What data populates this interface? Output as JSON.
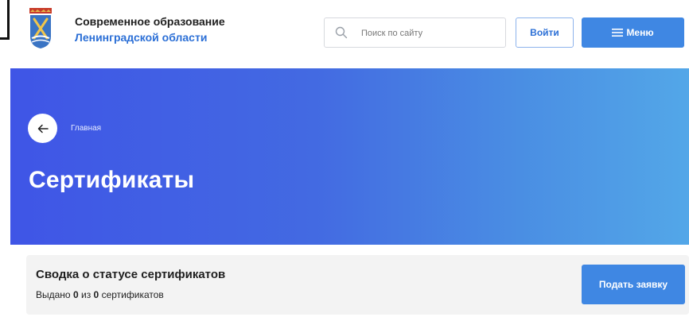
{
  "header": {
    "brand_line1": "Современное образование",
    "brand_line2": "Ленинградской области",
    "logo_icon": "leningrad-oblast-coat-of-arms",
    "search_placeholder": "Поиск по сайту",
    "search_value": "",
    "login_label": "Войти",
    "menu_label": "Меню"
  },
  "hero": {
    "breadcrumb": "Главная",
    "title": "Сертификаты",
    "gradient": [
      "#3f55e6",
      "#53a7e8"
    ]
  },
  "summary": {
    "title": "Сводка о статусе сертификатов",
    "status_prefix": "Выдано",
    "issued": "0",
    "status_middle": "из",
    "total": "0",
    "status_suffix": "сертификатов",
    "apply_label": "Подать заявку"
  },
  "colors": {
    "accent": "#3f87e3",
    "brand_blue": "#2b6fd6",
    "card_bg": "#f3f3f3"
  }
}
